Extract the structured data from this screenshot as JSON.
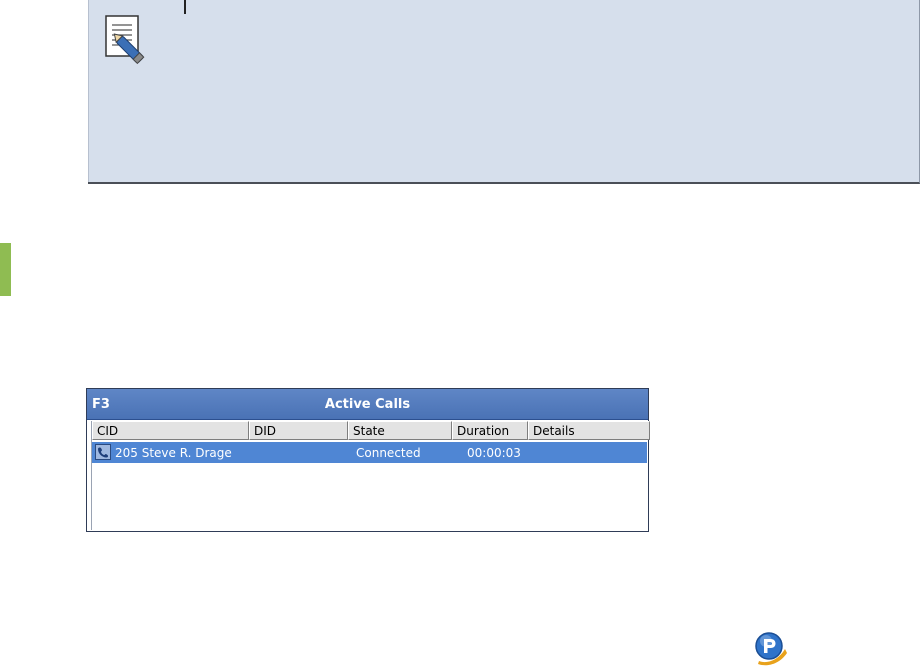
{
  "active_calls": {
    "key_label": "F3",
    "title": "Active Calls",
    "columns": [
      "CID",
      "DID",
      "State",
      "Duration",
      "Details"
    ],
    "rows": [
      {
        "icon": "phone-icon",
        "cid": "205 Steve R. Drage",
        "did": "",
        "state": "Connected",
        "duration": "00:00:03",
        "details": ""
      }
    ],
    "colors": {
      "titlebar": "#4f78bd",
      "selected_row": "#4f86d4"
    }
  },
  "icons": {
    "note": "note-pencil-icon",
    "logo": "p-logo-icon"
  },
  "accent_colors": {
    "note_background": "#d6dfec",
    "side_marker": "#8fbc52"
  }
}
